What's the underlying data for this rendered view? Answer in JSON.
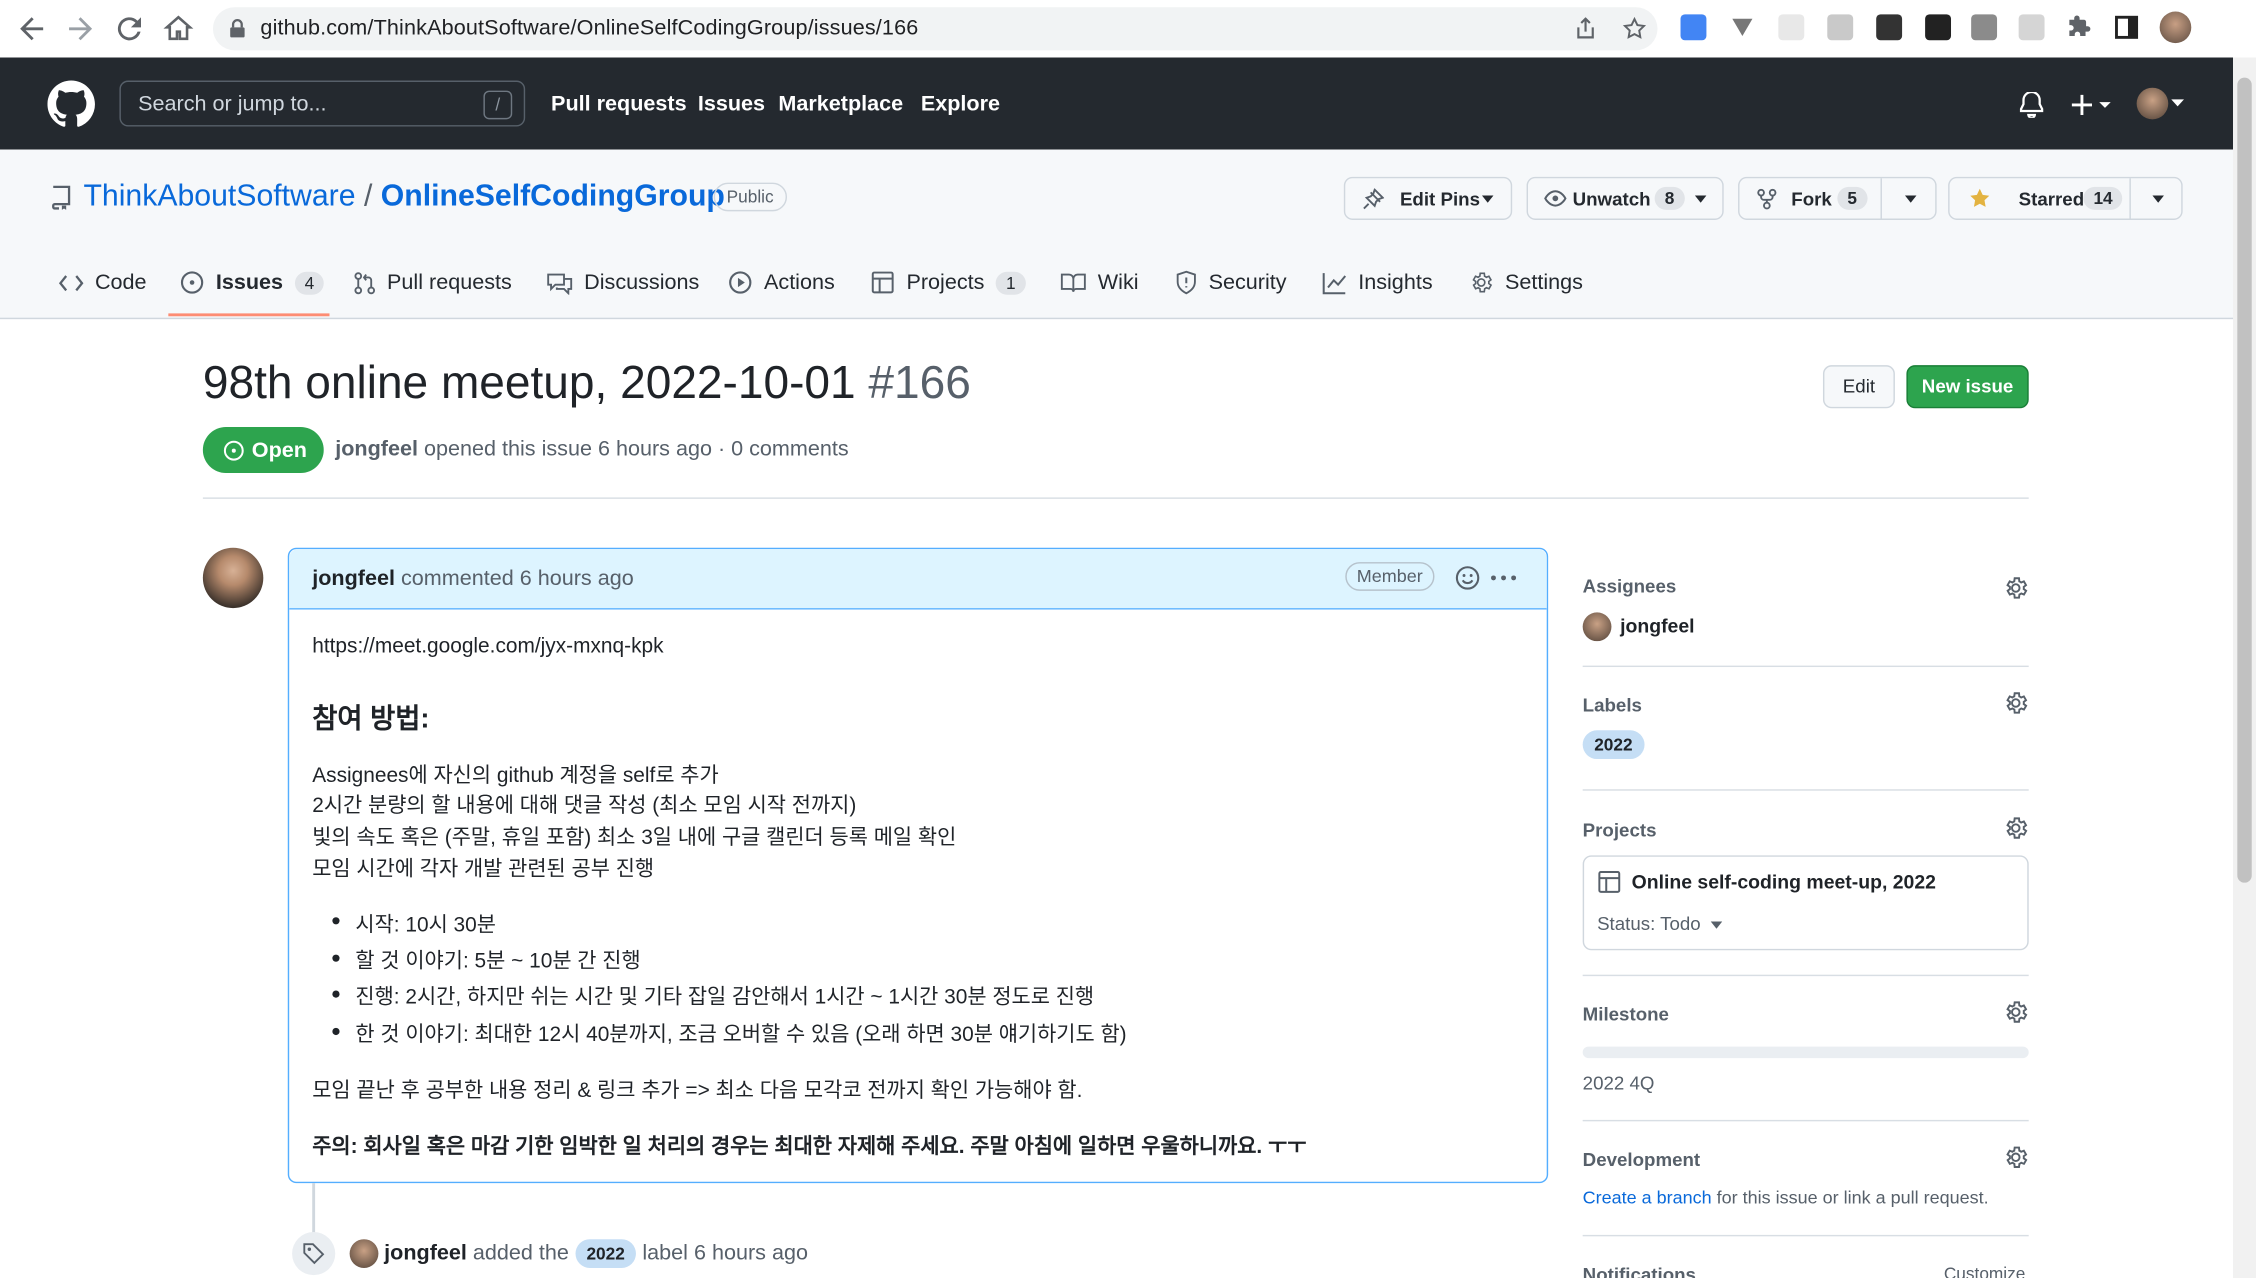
{
  "browser": {
    "url": "github.com/ThinkAboutSoftware/OnlineSelfCodingGroup/issues/166"
  },
  "header": {
    "search_placeholder": "Search or jump to...",
    "search_key": "/",
    "nav": [
      "Pull requests",
      "Issues",
      "Marketplace",
      "Explore"
    ]
  },
  "repo": {
    "owner": "ThinkAboutSoftware",
    "separator": "/",
    "name": "OnlineSelfCodingGroup",
    "visibility": "Public",
    "edit_pins": "Edit Pins",
    "unwatch": "Unwatch",
    "watch_count": "8",
    "fork": "Fork",
    "fork_count": "5",
    "starred": "Starred",
    "star_count": "14"
  },
  "tabs": [
    {
      "label": "Code"
    },
    {
      "label": "Issues",
      "count": "4"
    },
    {
      "label": "Pull requests"
    },
    {
      "label": "Discussions"
    },
    {
      "label": "Actions"
    },
    {
      "label": "Projects",
      "count": "1"
    },
    {
      "label": "Wiki"
    },
    {
      "label": "Security"
    },
    {
      "label": "Insights"
    },
    {
      "label": "Settings"
    }
  ],
  "issue": {
    "title": "98th online meetup, 2022-10-01",
    "number": "#166",
    "state": "Open",
    "author": "jongfeel",
    "opened_text": "opened this issue 6 hours ago · 0 comments",
    "edit_label": "Edit",
    "new_issue_label": "New issue"
  },
  "comment": {
    "author": "jongfeel",
    "time": "commented 6 hours ago",
    "role": "Member",
    "link": "https://meet.google.com/jyx-mxnq-kpk",
    "heading": "참여 방법:",
    "lines": [
      "Assignees에 자신의 github 계정을 self로 추가",
      "2시간 분량의 할 내용에 대해 댓글 작성 (최소 모임 시작 전까지)",
      "빛의 속도 혹은 (주말, 휴일 포함) 최소 3일 내에 구글 캘린더 등록 메일 확인",
      "모임 시간에 각자 개발 관련된 공부 진행"
    ],
    "bullets": [
      "시작: 10시 30분",
      "할 것 이야기: 5분 ~ 10분 간 진행",
      "진행: 2시간, 하지만 쉬는 시간 및 기타 잡일 감안해서 1시간 ~ 1시간 30분 정도로 진행",
      "한 것 이야기: 최대한 12시 40분까지, 조금 오버할 수 있음 (오래 하면 30분 얘기하기도 함)"
    ],
    "after": "모임 끝난 후 공부한 내용 정리 & 링크 추가 => 최소 다음 모각코 전까지 확인 가능해야 함.",
    "warning": "주의: 회사일 혹은 마감 기한 임박한 일 처리의 경우는 최대한 자제해 주세요. 주말 아침에 일하면 우울하니까요. ㅜㅜ"
  },
  "timeline": {
    "author": "jongfeel",
    "added": "added the",
    "label": "2022",
    "suffix": "label 6 hours ago"
  },
  "sidebar": {
    "assignees_title": "Assignees",
    "assignee": "jongfeel",
    "labels_title": "Labels",
    "label": "2022",
    "projects_title": "Projects",
    "project_name": "Online self-coding meet-up, 2022",
    "project_status": "Status: Todo",
    "milestone_title": "Milestone",
    "milestone_name": "2022 4Q",
    "milestone_progress": 0,
    "development_title": "Development",
    "dev_link": "Create a branch",
    "dev_text": "for this issue or link a pull request.",
    "notifications_title": "Notifications",
    "customize": "Customize"
  },
  "colors": {
    "header_bg": "#24292f",
    "link": "#0969da",
    "open_green": "#2da44e",
    "comment_header_bg": "#ddf4ff",
    "label_bg": "#c5def5"
  }
}
